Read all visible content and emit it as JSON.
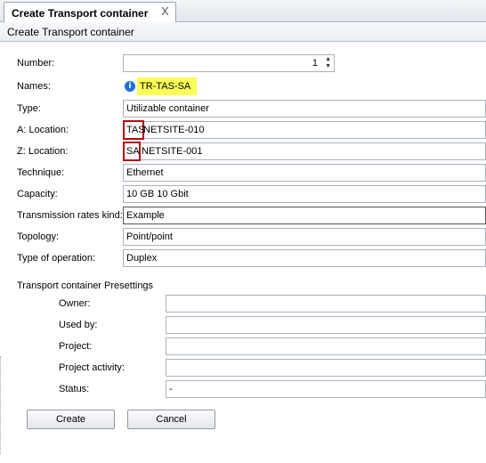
{
  "tab": {
    "label": "Create Transport container",
    "close_glyph": "X"
  },
  "header": {
    "title": "Create Transport container"
  },
  "form": {
    "number": {
      "label": "Number:",
      "value": "1"
    },
    "names": {
      "label": "Names:",
      "value": "TR-TAS-SA"
    },
    "type": {
      "label": "Type:",
      "value": "Utilizable container"
    },
    "a_location": {
      "label": "A: Location:",
      "prefix": "TAS",
      "value": "NETSITE-010"
    },
    "z_location": {
      "label": "Z: Location:",
      "prefix": "SA",
      "value": "NETSITE-001"
    },
    "technique": {
      "label": "Technique:",
      "value": "Ethernet"
    },
    "capacity": {
      "label": "Capacity:",
      "value": "10 GB 10 Gbit"
    },
    "transmission_rates": {
      "label": "Transmission rates kind:",
      "value": "Example"
    },
    "topology": {
      "label": "Topology:",
      "value": "Point/point"
    },
    "type_of_operation": {
      "label": "Type of operation:",
      "value": "Duplex"
    }
  },
  "presettings": {
    "title": "Transport container Presettings",
    "owner": {
      "label": "Owner:",
      "value": ""
    },
    "used_by": {
      "label": "Used by:",
      "value": ""
    },
    "project": {
      "label": "Project:",
      "value": ""
    },
    "project_activity": {
      "label": "Project activity:",
      "value": ""
    },
    "status": {
      "label": "Status:",
      "value": "-"
    }
  },
  "buttons": {
    "create": "Create",
    "cancel": "Cancel"
  },
  "colors": {
    "highlight": "#fbff57",
    "annotation_red": "#b50c0c",
    "info_blue": "#1d6fd8"
  },
  "icons": {
    "info": "info-icon",
    "spinner": "spinner-icon",
    "close": "close-icon"
  }
}
